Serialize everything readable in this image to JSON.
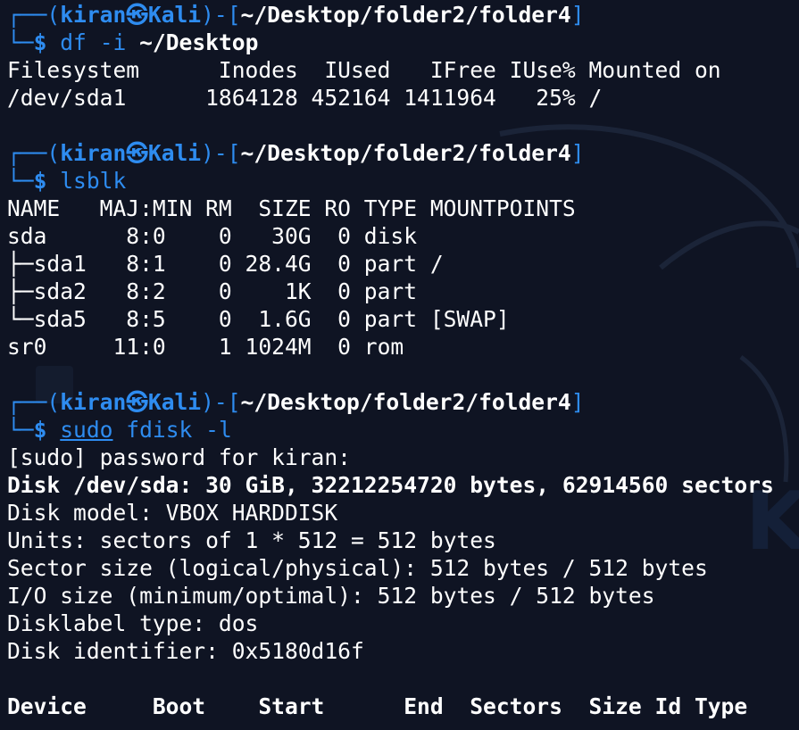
{
  "prompt": {
    "corner_top": "┌──",
    "corner_bottom": "└─",
    "open_paren": "(",
    "user": "kiran",
    "kali_symbol": "㉿",
    "host": "Kali",
    "close_paren": ")-[",
    "path": "~/Desktop/folder2/folder4",
    "close_bracket": "]",
    "dollar": "$"
  },
  "block1": {
    "command": "df",
    "arg1": "-i",
    "arg2": "~/Desktop",
    "output": [
      "Filesystem      Inodes  IUsed   IFree IUse% Mounted on",
      "/dev/sda1      1864128 452164 1411964   25% /"
    ]
  },
  "block2": {
    "command": "lsblk",
    "output": [
      "NAME   MAJ:MIN RM  SIZE RO TYPE MOUNTPOINTS",
      "sda      8:0    0   30G  0 disk",
      "├─sda1   8:1    0 28.4G  0 part /",
      "├─sda2   8:2    0    1K  0 part",
      "└─sda5   8:5    0  1.6G  0 part [SWAP]",
      "sr0     11:0    1 1024M  0 rom"
    ]
  },
  "block3": {
    "command_sudo": "sudo",
    "command": "fdisk",
    "arg1": "-l",
    "output": [
      "[sudo] password for kiran:",
      "Disk /dev/sda: 30 GiB, 32212254720 bytes, 62914560 sectors",
      "Disk model: VBOX HARDDISK",
      "Units: sectors of 1 * 512 = 512 bytes",
      "Sector size (logical/physical): 512 bytes / 512 bytes",
      "I/O size (minimum/optimal): 512 bytes / 512 bytes",
      "Disklabel type: dos",
      "Disk identifier: 0x5180d16f",
      "",
      "Device     Boot    Start      End  Sectors  Size Id Type"
    ]
  },
  "colors": {
    "background": "#0f1423",
    "accent": "#2e8cf0",
    "text": "#ffffff"
  }
}
